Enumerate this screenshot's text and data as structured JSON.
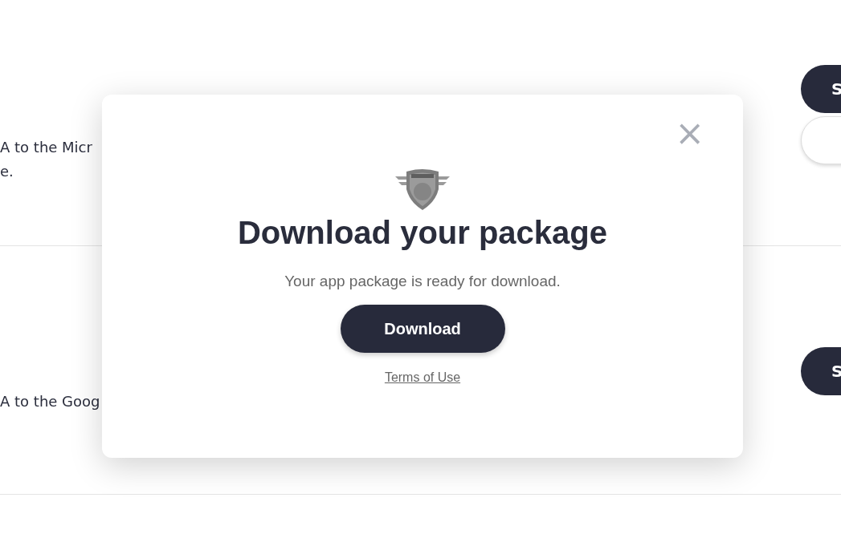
{
  "rows": [
    {
      "lines": [
        "A to the Micr",
        "e."
      ],
      "buttons": [
        {
          "label": "S",
          "kind": "primary"
        },
        {
          "kind": "outline"
        }
      ]
    },
    {
      "lines": [
        "A to the Goog"
      ],
      "buttons": [
        {
          "label": "S",
          "kind": "primary"
        }
      ]
    }
  ],
  "dialog": {
    "title": "Download your package",
    "message": "Your app package is ready for download.",
    "button": "Download",
    "link": "Terms of Use",
    "close": "×"
  }
}
